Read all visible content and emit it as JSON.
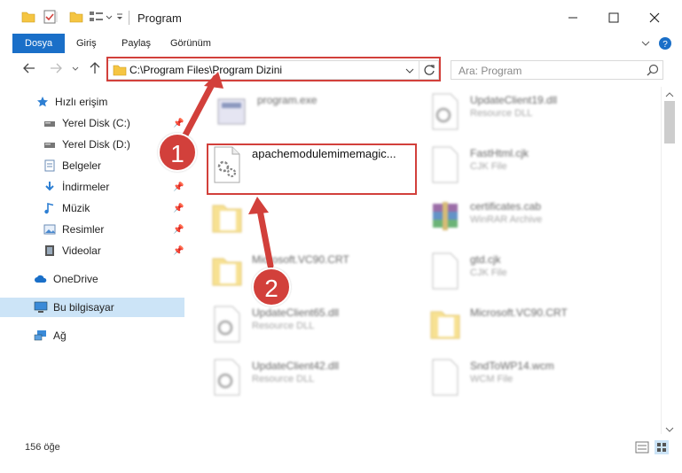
{
  "window": {
    "title": "Program",
    "colors": {
      "accent": "#1a6fc8",
      "annotation": "#d2403b",
      "selected": "#cce4f7"
    }
  },
  "ribbon": {
    "tabs": [
      {
        "label": "Dosya",
        "active": true
      },
      {
        "label": "Giriş",
        "active": false
      },
      {
        "label": "Paylaş",
        "active": false
      },
      {
        "label": "Görünüm",
        "active": false
      }
    ]
  },
  "address": {
    "path": "C:\\Program Files\\Program Dizini",
    "search_placeholder": "Ara: Program"
  },
  "sidebar": {
    "items": [
      {
        "label": "Hızlı erişim",
        "icon": "star-icon"
      },
      {
        "label": "Yerel Disk (C:)",
        "icon": "drive-icon",
        "pinned": true
      },
      {
        "label": "Yerel Disk (D:)",
        "icon": "drive-icon"
      },
      {
        "label": "Belgeler",
        "icon": "documents-icon"
      },
      {
        "label": "İndirmeler",
        "icon": "download-icon",
        "pinned": true
      },
      {
        "label": "Müzik",
        "icon": "music-icon",
        "pinned": true
      },
      {
        "label": "Resimler",
        "icon": "pictures-icon",
        "pinned": true
      },
      {
        "label": "Videolar",
        "icon": "videos-icon",
        "pinned": true
      },
      {
        "label": "OneDrive",
        "icon": "cloud-icon"
      },
      {
        "label": "Bu bilgisayar",
        "icon": "computer-icon",
        "selected": true
      },
      {
        "label": "Ağ",
        "icon": "network-icon"
      }
    ]
  },
  "files": [
    {
      "name": "program.exe",
      "type": "",
      "icon": "exe-icon"
    },
    {
      "name": "UpdateClient19.dll",
      "type": "Resource DLL",
      "icon": "dll-icon"
    },
    {
      "name": "apachemodulemimemagic...",
      "type": "",
      "icon": "gear-file-icon"
    },
    {
      "name": "FastHtml.cjk",
      "type": "CJK File",
      "icon": "blank-file-icon"
    },
    {
      "name": "",
      "type": "",
      "icon": "folder-icon"
    },
    {
      "name": "certificates.cab",
      "type": "WinRAR Archive",
      "icon": "winrar-icon"
    },
    {
      "name": "Microsoft.VC90.CRT",
      "type": "",
      "icon": "folder-icon"
    },
    {
      "name": "gtd.cjk",
      "type": "CJK File",
      "icon": "blank-file-icon"
    },
    {
      "name": "UpdateClient65.dll",
      "type": "Resource DLL",
      "icon": "dll-icon"
    },
    {
      "name": "Microsoft.VC90.CRT",
      "type": "",
      "icon": "folder-icon"
    },
    {
      "name": "UpdateClient42.dll",
      "type": "Resource DLL",
      "icon": "dll-icon"
    },
    {
      "name": "SndToWP14.wcm",
      "type": "WCM File",
      "icon": "blank-file-icon"
    }
  ],
  "status": {
    "count": "156 öğe"
  },
  "annotations": {
    "step1": "1",
    "step2": "2"
  }
}
